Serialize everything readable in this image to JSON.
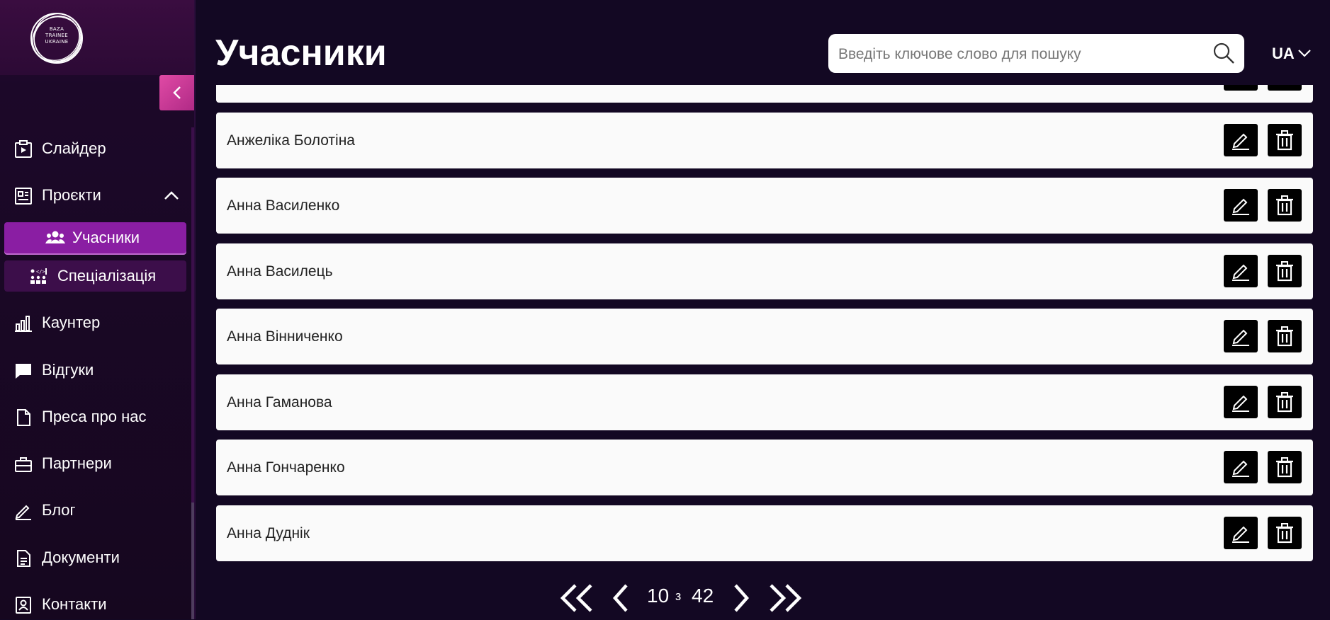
{
  "logo": {
    "text_lines": [
      "BAZA",
      "TRAINEE",
      "UKRAINE"
    ]
  },
  "sidebar": {
    "items": [
      {
        "label": "Слайдер",
        "icon": "slider-icon"
      },
      {
        "label": "Проєкти",
        "icon": "projects-icon",
        "expanded": true
      },
      {
        "label": "Каунтер",
        "icon": "counter-icon"
      },
      {
        "label": "Відгуки",
        "icon": "reviews-icon"
      },
      {
        "label": "Преса про нас",
        "icon": "press-icon"
      },
      {
        "label": "Партнери",
        "icon": "partners-icon"
      },
      {
        "label": "Блог",
        "icon": "blog-icon"
      },
      {
        "label": "Документи",
        "icon": "documents-icon"
      },
      {
        "label": "Контакти",
        "icon": "contacts-icon"
      }
    ],
    "sub_items": [
      {
        "label": "Учасники",
        "icon": "participants-icon",
        "active": true
      },
      {
        "label": "Спеціалізація",
        "icon": "specialization-icon",
        "active": false
      }
    ]
  },
  "header": {
    "title": "Учасники",
    "search_placeholder": "Введіть ключове слово для пошуку",
    "language": "UA"
  },
  "participants": [
    "Анжеліка Болотіна",
    "Анна Василенко",
    "Анна Василець",
    "Анна Вінниченко",
    "Анна Гаманова",
    "Анна Гончаренко",
    "Анна Дуднік"
  ],
  "pagination": {
    "current": "10",
    "separator": "з",
    "total": "42"
  },
  "colors": {
    "background": "#130823",
    "accent": "#8a1ea3",
    "collapse_button": "#d03c98",
    "row": "#fafafa",
    "action_button": "#000000"
  }
}
